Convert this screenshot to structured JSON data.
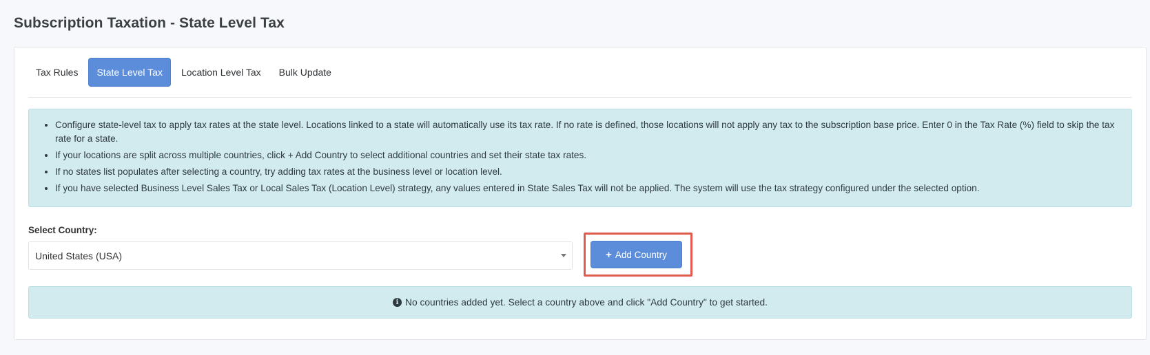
{
  "page": {
    "title": "Subscription Taxation - State Level Tax"
  },
  "tabs": [
    {
      "label": "Tax Rules",
      "active": false
    },
    {
      "label": "State Level Tax",
      "active": true
    },
    {
      "label": "Location Level Tax",
      "active": false
    },
    {
      "label": "Bulk Update",
      "active": false
    }
  ],
  "info": {
    "items": [
      "Configure state-level tax to apply tax rates at the state level. Locations linked to a state will automatically use its tax rate. If no rate is defined, those locations will not apply any tax to the subscription base price. Enter 0 in the Tax Rate (%) field to skip the tax rate for a state.",
      "If your locations are split across multiple countries, click + Add Country to select additional countries and set their state tax rates.",
      "If no states list populates after selecting a country, try adding tax rates at the business level or location level.",
      "If you have selected Business Level Sales Tax or Local Sales Tax (Location Level) strategy, any values entered in State Sales Tax will not be applied. The system will use the tax strategy configured under the selected option."
    ]
  },
  "country": {
    "label": "Select Country:",
    "selected": "United States (USA)"
  },
  "add_button": {
    "icon": "+",
    "label": "Add Country"
  },
  "empty_state": {
    "icon": "i",
    "message": "No countries added yet. Select a country above and click \"Add Country\" to get started."
  },
  "colors": {
    "accent": "#5b8ddb",
    "info_bg": "#d2ebef",
    "highlight": "#e05a4e"
  }
}
